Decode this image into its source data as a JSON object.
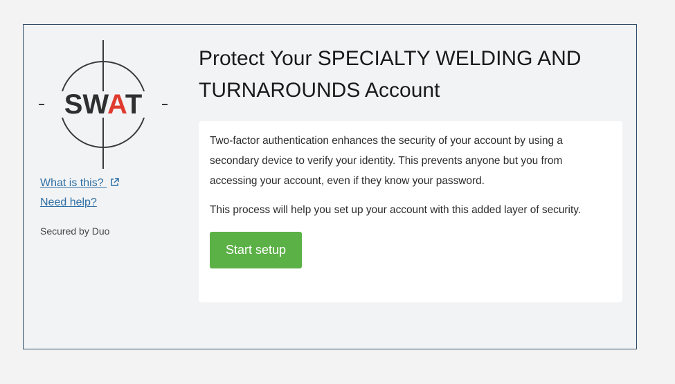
{
  "logo": {
    "text": "SWAT",
    "primary_color": "#2f2f2f",
    "accent_color": "#e03a2f"
  },
  "sidebar": {
    "what_is_this": "What is this?",
    "need_help": "Need help?",
    "secured_by": "Secured by Duo"
  },
  "main": {
    "title": "Protect Your SPECIALTY WELDING AND TURNAROUNDS Account",
    "paragraph1": "Two-factor authentication enhances the security of your account by using a secondary device to verify your identity. This prevents anyone but you from accessing your account, even if they know your password.",
    "paragraph2": "This process will help you set up your account with this added layer of security.",
    "start_button": "Start setup"
  },
  "colors": {
    "link": "#2e6ea3",
    "button": "#5cb146",
    "frame_border": "#2d4a63"
  }
}
